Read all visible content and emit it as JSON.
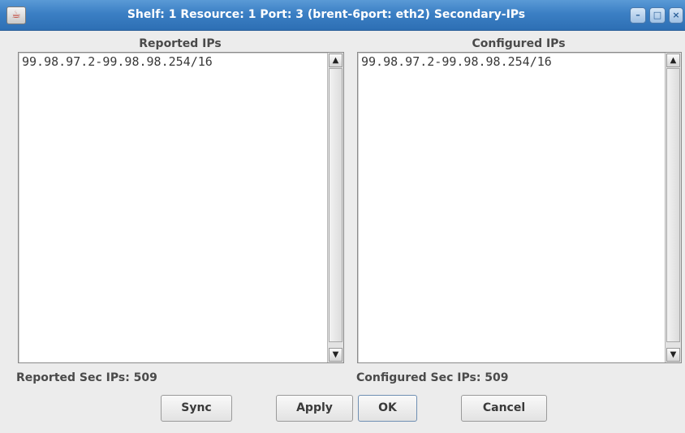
{
  "window": {
    "title": "Shelf: 1  Resource: 1  Port: 3  (brent-6port: eth2)  Secondary-IPs"
  },
  "reported": {
    "title": "Reported IPs",
    "items": [
      "99.98.97.2-99.98.98.254/16"
    ],
    "status": "Reported Sec IPs: 509"
  },
  "configured": {
    "title": "Configured IPs",
    "items": [
      "99.98.97.2-99.98.98.254/16"
    ],
    "status": "Configured Sec IPs: 509"
  },
  "buttons": {
    "sync": "Sync",
    "apply": "Apply",
    "ok": "OK",
    "cancel": "Cancel"
  },
  "icons": {
    "app": "java-cup-icon",
    "minimize": "minimize-icon",
    "maximize": "maximize-icon",
    "close": "close-icon",
    "scroll_up": "up-arrow-icon",
    "scroll_down": "down-arrow-icon"
  }
}
